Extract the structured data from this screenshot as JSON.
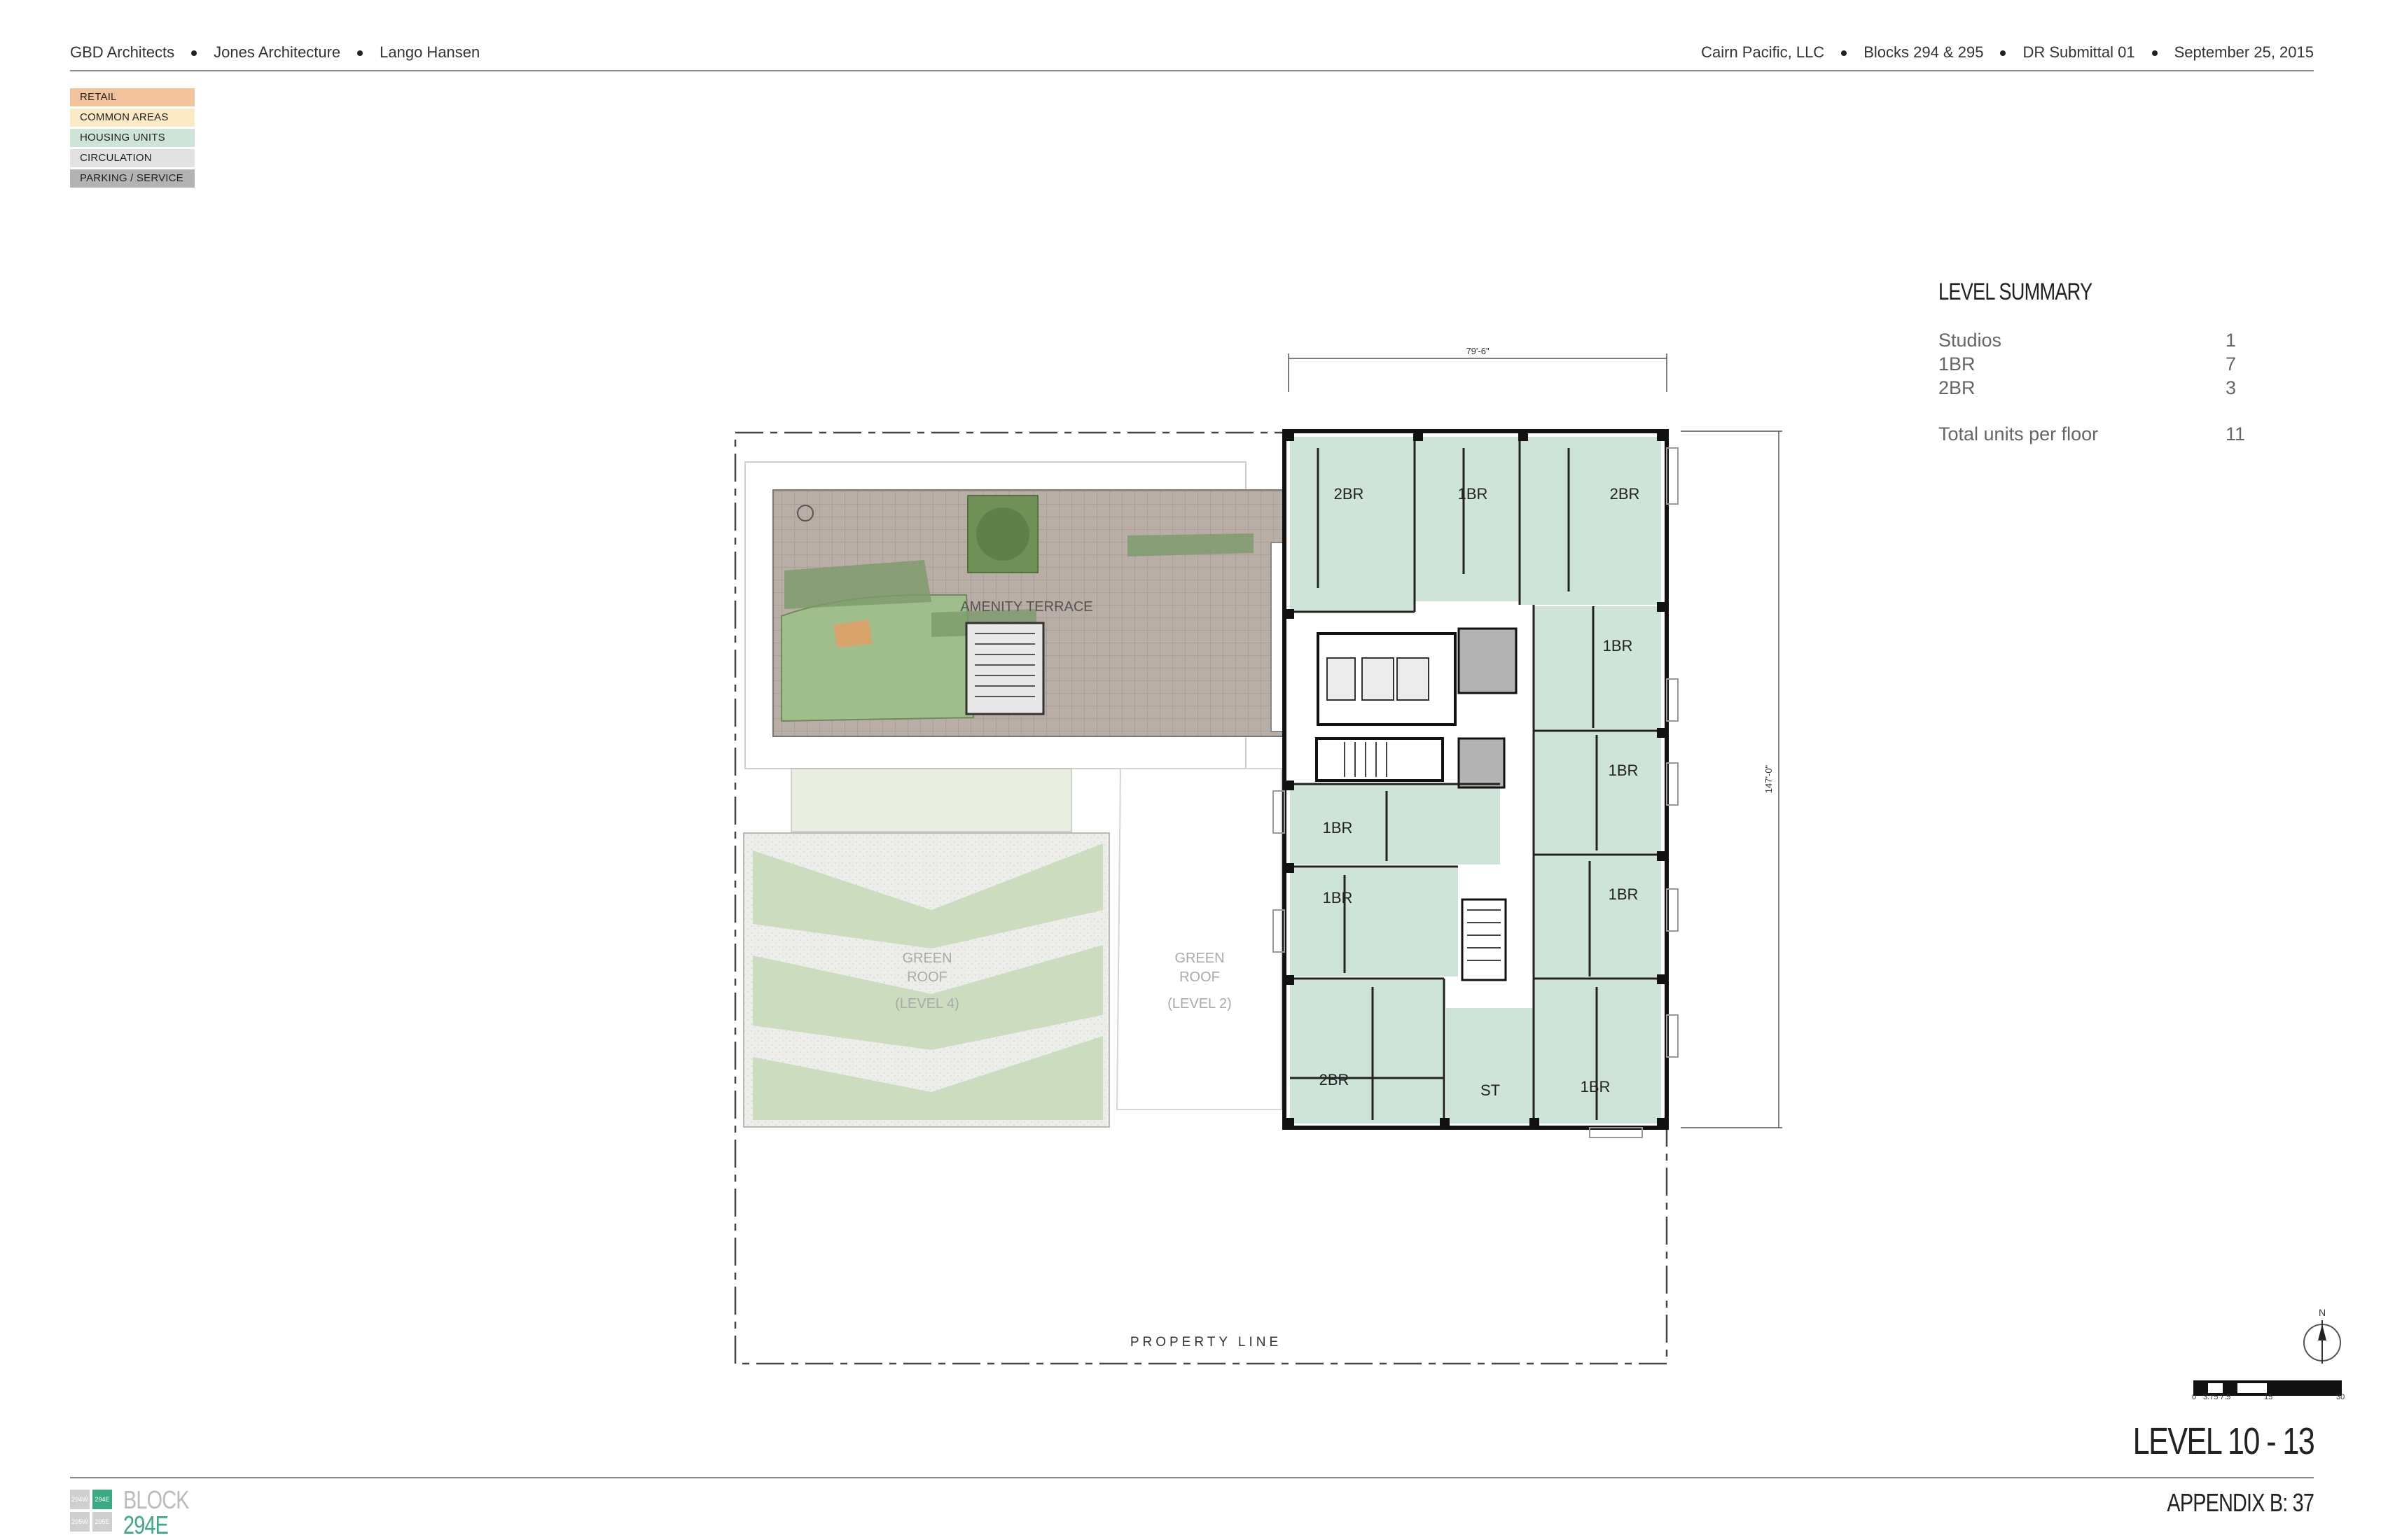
{
  "header": {
    "left": [
      "GBD Architects",
      "Jones Architecture",
      "Lango Hansen"
    ],
    "right": [
      "Cairn Pacific, LLC",
      "Blocks 294 & 295",
      "DR Submittal 01",
      "September 25, 2015"
    ]
  },
  "legend": [
    {
      "label": "RETAIL",
      "color": "#f3c39c"
    },
    {
      "label": "COMMON AREAS",
      "color": "#fbeac3"
    },
    {
      "label": "HOUSING UNITS",
      "color": "#cfe4d9"
    },
    {
      "label": "CIRCULATION",
      "color": "#e2e2e2"
    },
    {
      "label": "PARKING / SERVICE",
      "color": "#b3b3b3"
    }
  ],
  "level_summary": {
    "title": "LEVEL SUMMARY",
    "rows": [
      {
        "label": "Studios",
        "value": "1"
      },
      {
        "label": "1BR",
        "value": "7"
      },
      {
        "label": "2BR",
        "value": "3"
      }
    ],
    "total": {
      "label": "Total units per floor",
      "value": "11"
    }
  },
  "plan": {
    "dim_width": "79'-6\"",
    "dim_height": "147'-0\"",
    "amenity_label": "AMENITY TERRACE",
    "green_roof_l4": [
      "GREEN",
      "ROOF",
      "(LEVEL 4)"
    ],
    "green_roof_l2": [
      "GREEN",
      "ROOF",
      "(LEVEL 2)"
    ],
    "property_line": "PROPERTY LINE",
    "units": [
      "2BR",
      "1BR",
      "2BR",
      "1BR",
      "1BR",
      "1BR",
      "1BR",
      "1BR",
      "2BR",
      "ST",
      "1BR"
    ],
    "north": "N"
  },
  "scale_bar": {
    "ticks": [
      "0",
      "3.75",
      "7.5",
      "15",
      "30"
    ]
  },
  "level_title": "LEVEL 10 - 13",
  "appendix": "APPENDIX B: 37",
  "block": {
    "word": "BLOCK",
    "code": "294E",
    "cells": [
      "294W",
      "294E",
      "295W",
      "295E"
    ]
  },
  "colors": {
    "housing": "#cfe4d9",
    "accent": "#3aa985",
    "terrace": "#b8aca4",
    "lawn": "#9fbe8c"
  }
}
